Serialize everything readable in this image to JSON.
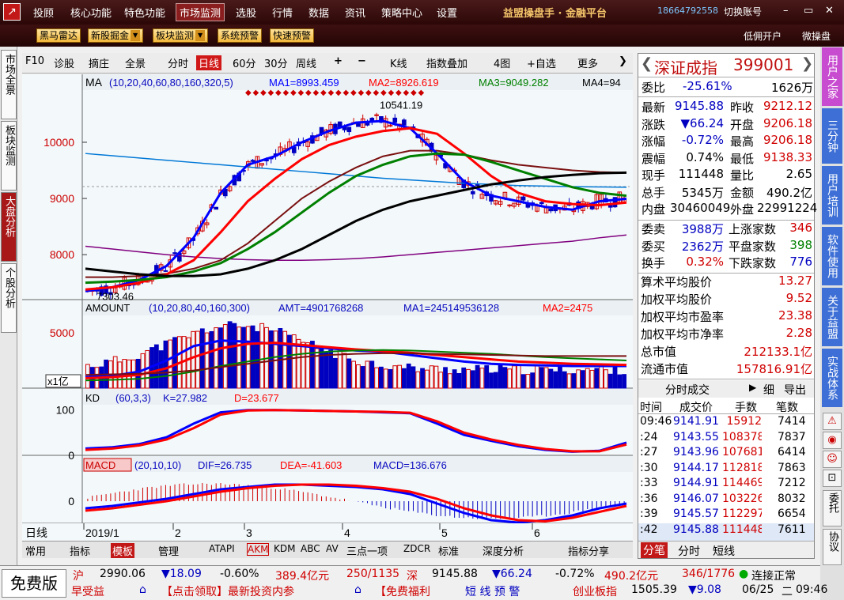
{
  "menubar": {
    "items": [
      "投顾",
      "核心功能",
      "特色功能",
      "市场监测",
      "选股",
      "行情",
      "数据",
      "资讯",
      "策略中心",
      "设置"
    ],
    "selected": "市场监测",
    "brand": "益盟操盘手 · 金融平台",
    "phone": "18664792558",
    "switch_account": "切换账号"
  },
  "toolbar": {
    "buttons": [
      "黑马雷达",
      "新股掘金",
      "板块监测",
      "系统预警",
      "快速预警"
    ],
    "right": [
      "低佣开户",
      "微操盘"
    ]
  },
  "left_tabs": [
    "市场全景",
    "板块监测",
    "大盘分析",
    "个股分析"
  ],
  "chart_toolbar": {
    "items": [
      "F10",
      "诊股",
      "摘庄",
      "全景",
      "分时",
      "日线",
      "60分",
      "30分",
      "周线",
      "K线",
      "指数叠加",
      "4图",
      "自选",
      "更多"
    ],
    "selected": "日线"
  },
  "ma_panel": {
    "label": "MA",
    "params": "(10,20,40,60,80,160,320,5)",
    "ma1": "MA1=8993.459",
    "ma2": "MA2=8926.619",
    "ma3": "MA3=9049.282",
    "ma4": "MA4=94",
    "high_label": "10541.19",
    "low_label": "7303.46",
    "y_ticks": [
      "10000",
      "9000",
      "8000"
    ]
  },
  "amount_panel": {
    "label": "AMOUNT",
    "params": "(10,20,80,40,160,300)",
    "amt": "AMT=4901768268",
    "ma1": "MA1=245149536128",
    "ma2": "MA2=2475",
    "y_ticks": [
      "5000"
    ],
    "unit": "x1亿"
  },
  "kd_panel": {
    "label": "KD",
    "params": "(60,3,3)",
    "k": "K=27.982",
    "d": "D=23.677",
    "y_ticks": [
      "100",
      "0"
    ]
  },
  "macd_panel": {
    "label": "MACD",
    "params": "(20,10,10)",
    "dif": "DIF=26.735",
    "dea": "DEA=-41.603",
    "macd": "MACD=136.676",
    "y_ticks": [
      "0"
    ]
  },
  "x_axis": {
    "period": "日线",
    "labels": [
      "2019/1",
      "2",
      "3",
      "4",
      "5",
      "6"
    ]
  },
  "bottom_tabs": [
    "常用",
    "指标",
    "模板",
    "管理",
    "ATAPI",
    "AKM",
    "KDM",
    "ABC",
    "AV",
    "三点一项",
    "ZDCR",
    "标准",
    "深度分析",
    "指标分享"
  ],
  "bottom_selected": "模板",
  "quote": {
    "name": "深证成指",
    "code": "399001",
    "weibi_label": "委比",
    "weibi": "-25.61%",
    "weicha": "1626万",
    "rows": [
      [
        "最新",
        "9145.88",
        "昨收",
        "9212.12"
      ],
      [
        "涨跌",
        "▼66.24",
        "开盘",
        "9206.18"
      ],
      [
        "涨幅",
        "-0.72%",
        "最高",
        "9206.18"
      ],
      [
        "震幅",
        "0.74%",
        "最低",
        "9138.33"
      ],
      [
        "现手",
        "111448",
        "量比",
        "2.65"
      ],
      [
        "总手",
        "5345万",
        "金额",
        "490.2亿"
      ],
      [
        "内盘",
        "30460049",
        "外盘",
        "22991224"
      ]
    ],
    "rows2": [
      [
        "委卖",
        "3988万",
        "上涨家数",
        "346"
      ],
      [
        "委买",
        "2362万",
        "平盘家数",
        "398"
      ],
      [
        "换手",
        "0.32%",
        "下跌家数",
        "776"
      ]
    ],
    "stats": [
      [
        "算术平均股价",
        "13.27"
      ],
      [
        "加权平均股价",
        "9.52"
      ],
      [
        "加权平均市盈率",
        "23.38"
      ],
      [
        "加权平均市净率",
        "2.28"
      ],
      [
        "总市值",
        "212133.1亿"
      ],
      [
        "流通市值",
        "157816.91亿"
      ]
    ],
    "tick_header": "分时成交",
    "tick_btns": [
      "细",
      "导出"
    ],
    "tick_cols": [
      "时间",
      "成交价",
      "手数",
      "笔数"
    ],
    "ticks": [
      [
        "09:46",
        "9141.91",
        "15912",
        "7414"
      ],
      [
        ":24",
        "9143.55",
        "108378",
        "7837"
      ],
      [
        ":27",
        "9143.96",
        "107681",
        "6414"
      ],
      [
        ":30",
        "9144.17",
        "112818",
        "7863"
      ],
      [
        ":33",
        "9144.91",
        "114469",
        "7212"
      ],
      [
        ":36",
        "9146.07",
        "103226",
        "8032"
      ],
      [
        ":39",
        "9145.57",
        "112297",
        "6654"
      ],
      [
        ":42",
        "9145.88",
        "111448",
        "7611"
      ]
    ],
    "bottom_tabs": [
      "分笔",
      "分时",
      "短线"
    ]
  },
  "right_tabs": [
    "用户之家",
    "三分钟",
    "用户培训",
    "软件使用",
    "关于益盟",
    "实战体系"
  ],
  "right_texts": [
    "委托",
    "协议"
  ],
  "statusbar": {
    "free": "免费版",
    "sh": {
      "name": "沪",
      "price": "2990.06",
      "chg": "▼18.09",
      "pct": "-0.60%",
      "amt": "389.4亿元",
      "updown": "250/1135"
    },
    "sz": {
      "name": "深",
      "price": "9145.88",
      "chg": "▼66.24",
      "pct": "-0.72%",
      "amt": "490.2亿元",
      "updown": "346/1776"
    },
    "conn": "连接正常",
    "ticker1": "早受益",
    "ticker2": "【点击领取】最新投资内参",
    "ticker3": "【免费福利",
    "alert": "短 线 预 警",
    "cy_name": "创业板指",
    "cy_price": "1505.39",
    "cy_chg": "▼9.08",
    "date": "06/25",
    "weekday": "二",
    "time": "09:46"
  },
  "colors": {
    "up": "#d00000",
    "down": "#0000c0",
    "ma1": "#0000ff",
    "ma2": "#ff0000",
    "ma3": "#008000",
    "ma4": "#000000",
    "ma5": "#7a1010",
    "ma6": "#0078d7",
    "ma7": "#800080"
  },
  "chart_data": [
    {
      "type": "line",
      "title": "MA (10,20,40,60,80,160,320,5)",
      "x_labels": [
        "2019/1",
        "2",
        "3",
        "4",
        "5",
        "6"
      ],
      "ylim": [
        7200,
        10900
      ],
      "series": [
        {
          "name": "MA1",
          "values": [
            7350,
            7420,
            7550,
            7800,
            8300,
            9100,
            9600,
            9750,
            10000,
            10200,
            10350,
            10380,
            10250,
            9800,
            9300,
            9050,
            8950,
            8850,
            8800,
            8950,
            8993
          ]
        },
        {
          "name": "MA2",
          "values": [
            7380,
            7420,
            7500,
            7650,
            7900,
            8400,
            8950,
            9350,
            9700,
            9950,
            10100,
            10200,
            10250,
            10150,
            9800,
            9400,
            9100,
            8950,
            8900,
            8880,
            8927
          ]
        },
        {
          "name": "MA3",
          "values": [
            7500,
            7520,
            7550,
            7600,
            7700,
            7850,
            8100,
            8400,
            8750,
            9100,
            9400,
            9600,
            9750,
            9800,
            9780,
            9650,
            9500,
            9350,
            9200,
            9100,
            9049
          ]
        },
        {
          "name": "MA4",
          "values": [
            7750,
            7700,
            7650,
            7620,
            7620,
            7650,
            7750,
            7900,
            8100,
            8350,
            8600,
            8800,
            8950,
            9050,
            9150,
            9250,
            9320,
            9380,
            9420,
            9450,
            9460
          ]
        }
      ]
    },
    {
      "type": "line",
      "title": "KD (60,3,3)",
      "ylim": [
        0,
        110
      ],
      "series": [
        {
          "name": "K",
          "values": [
            15,
            18,
            25,
            40,
            70,
            95,
            100,
            100,
            99,
            98,
            97,
            95,
            93,
            70,
            45,
            32,
            20,
            12,
            8,
            10,
            28
          ]
        },
        {
          "name": "D",
          "values": [
            12,
            15,
            22,
            35,
            60,
            90,
            99,
            100,
            99,
            98,
            97,
            96,
            94,
            75,
            50,
            35,
            23,
            14,
            9,
            9,
            24
          ]
        }
      ]
    }
  ]
}
